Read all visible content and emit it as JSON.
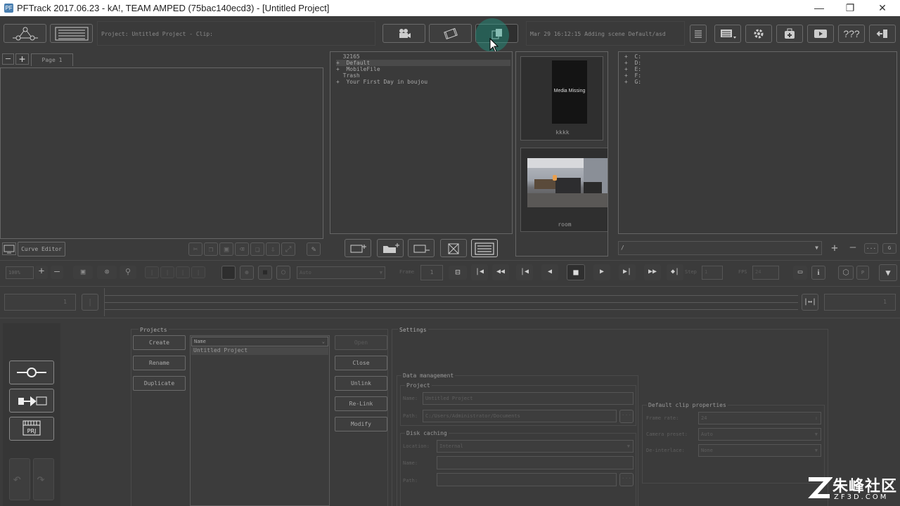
{
  "window": {
    "title": "PFTrack 2017.06.23 - kA!, TEAM AMPED (75bac140ecd3) - [Untitled Project]",
    "icon": "pftrack-app-icon",
    "min": "—",
    "restore": "❐",
    "close": "✕"
  },
  "header": {
    "project_info": "Project: Untitled Project - Clip:",
    "status": "Mar 29 16:12:15 Adding scene Default/asd",
    "help": "???"
  },
  "page_tabs": {
    "tab": "Page 1"
  },
  "left_tools": {
    "curve_editor": "Curve Editor"
  },
  "clip_tree": {
    "items": [
      {
        "prefix": " ",
        "label": "32165"
      },
      {
        "prefix": "+",
        "label": "Default"
      },
      {
        "prefix": "+",
        "label": "MobileFile"
      },
      {
        "prefix": " ",
        "label": "Trash"
      },
      {
        "prefix": "+",
        "label": "Your First Day in boujou"
      }
    ]
  },
  "thumbnails": {
    "media_missing": "Media Missing",
    "clip1_name": "kkkk",
    "clip2_name": "room"
  },
  "drives": {
    "items": [
      {
        "prefix": "+",
        "label": "C:"
      },
      {
        "prefix": "+",
        "label": "D:"
      },
      {
        "prefix": "+",
        "label": "E:"
      },
      {
        "prefix": "+",
        "label": "F:"
      },
      {
        "prefix": "+",
        "label": "G:"
      }
    ],
    "path": "/",
    "more": "...",
    "g": "G"
  },
  "playback": {
    "zoom": "100%",
    "mode": "Auto",
    "frame_label": "Frame",
    "frame_value": "1",
    "step_label": "Step",
    "step_value": "1",
    "fps_label": "FPS",
    "fps_value": "24",
    "p": "P"
  },
  "timeline": {
    "start": "1",
    "end": "1"
  },
  "projects": {
    "section": "Projects",
    "create": "Create",
    "rename": "Rename",
    "duplicate": "Duplicate",
    "column_name": "Name",
    "rows": [
      "Untitled Project"
    ],
    "open": "Open",
    "close": "Close",
    "unlink": "Unlink",
    "relink": "Re-Link",
    "modify": "Modify"
  },
  "settings": {
    "section": "Settings",
    "data_management": "Data management",
    "project_group": "Project",
    "name_label": "Name:",
    "name_value": "Untitled Project",
    "path_label": "Path:",
    "path_value": "C:/Users/Administrator/Documents",
    "disk_caching": "Disk caching",
    "location_label": "Location:",
    "location_value": "Internal",
    "cache_name_label": "Name:",
    "cache_path_label": "Path:",
    "default_clip": "Default clip properties",
    "frame_rate_label": "Frame rate:",
    "frame_rate_value": "24",
    "camera_preset_label": "Camera preset:",
    "camera_preset_value": "Auto",
    "deinterlace_label": "De-interlace:",
    "deinterlace_value": "None"
  },
  "watermark": {
    "cn": "朱峰社区",
    "en": "ZF3D.COM"
  }
}
